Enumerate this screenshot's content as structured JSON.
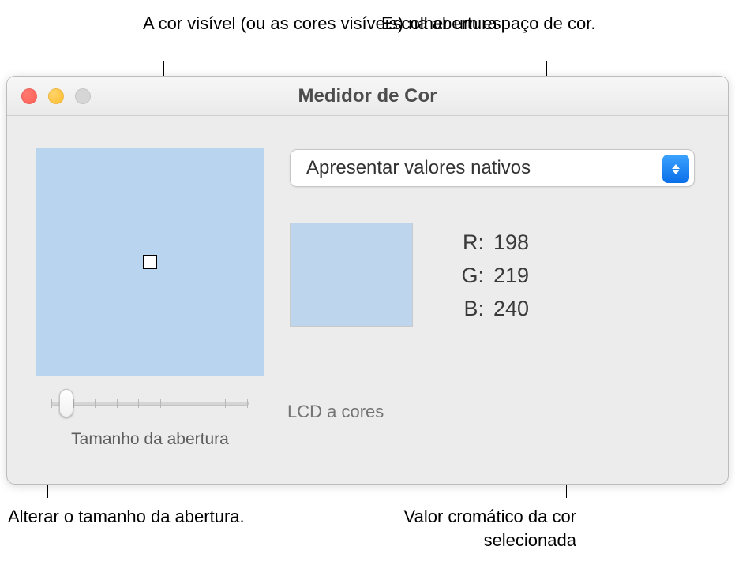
{
  "callouts": {
    "aperture_color": "A cor visível (ou as cores visíveis) na abertura",
    "choose_space": "Escolher um espaço de cor.",
    "change_size": "Alterar o tamanho da abertura.",
    "chroma_value": "Valor cromático da cor selecionada"
  },
  "window": {
    "title": "Medidor de Cor"
  },
  "dropdown": {
    "selected": "Apresentar valores nativos"
  },
  "values": {
    "r_label": "R:",
    "g_label": "G:",
    "b_label": "B:",
    "r": "198",
    "g": "219",
    "b": "240"
  },
  "display": {
    "name": "LCD a cores"
  },
  "slider": {
    "label": "Tamanho da abertura"
  }
}
